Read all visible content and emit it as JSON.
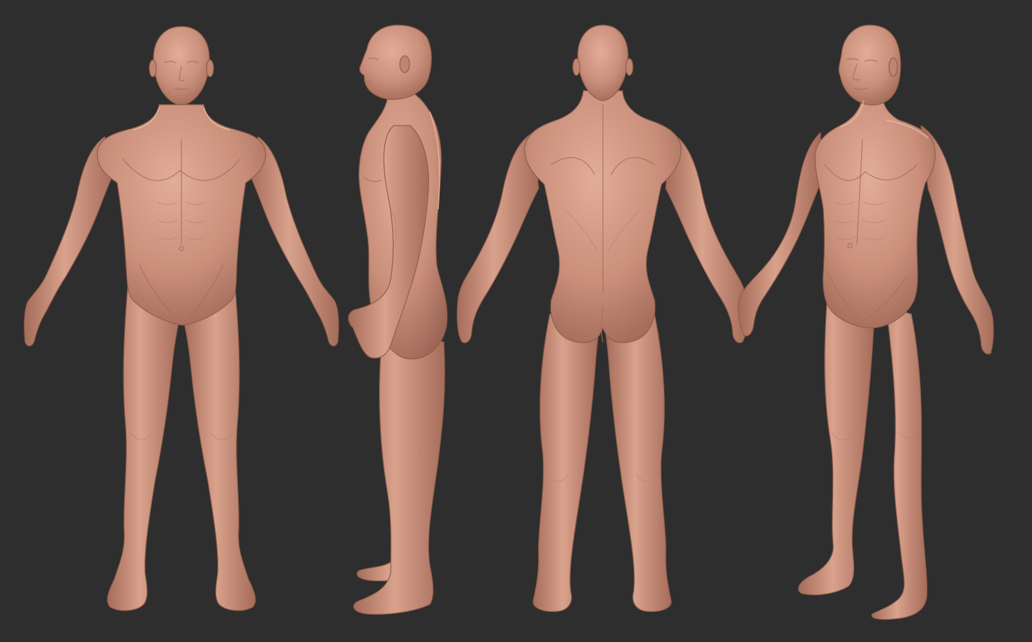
{
  "scene": {
    "background_color": "#2e2e2e",
    "skin_color": "#c98f7a",
    "skin_highlight": "#dca48e",
    "skin_shadow": "#9a6352",
    "views": [
      {
        "name": "front",
        "icon": "male-figure-front"
      },
      {
        "name": "side",
        "icon": "male-figure-side-left"
      },
      {
        "name": "back",
        "icon": "male-figure-back"
      },
      {
        "name": "three-quarter",
        "icon": "male-figure-three-quarter"
      }
    ]
  }
}
